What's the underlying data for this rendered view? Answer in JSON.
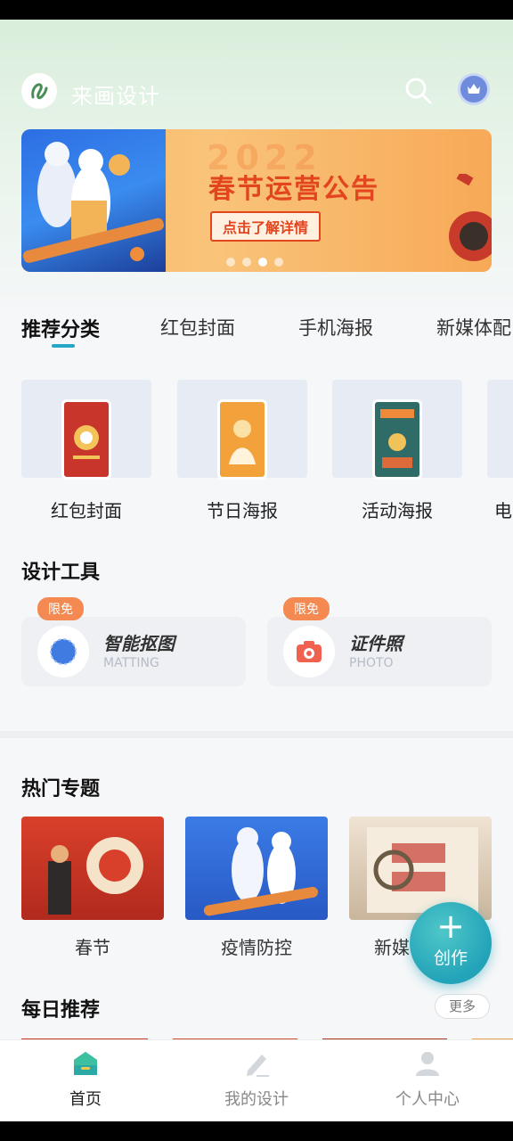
{
  "header": {
    "title": "来画设计"
  },
  "banner": {
    "year": "2022",
    "title": "春节运营公告",
    "cta": "点击了解详情",
    "dot_count": 4,
    "active_dot": 3
  },
  "tabs": [
    {
      "label": "推荐分类",
      "active": true
    },
    {
      "label": "红包封面",
      "active": false
    },
    {
      "label": "手机海报",
      "active": false
    },
    {
      "label": "新媒体配",
      "active": false
    }
  ],
  "categories": [
    {
      "label": "红包封面"
    },
    {
      "label": "节日海报"
    },
    {
      "label": "活动海报"
    },
    {
      "label": "电"
    }
  ],
  "tools_section": {
    "title": "设计工具",
    "items": [
      {
        "badge": "限免",
        "name": "智能抠图",
        "sub": "MATTING"
      },
      {
        "badge": "限免",
        "name": "证件照",
        "sub": "PHOTO"
      }
    ]
  },
  "hot_section": {
    "title": "热门专题",
    "items": [
      {
        "label": "春节"
      },
      {
        "label": "疫情防控"
      },
      {
        "label": "新媒"
      }
    ]
  },
  "daily_section": {
    "title": "每日推荐",
    "more": "更多"
  },
  "fab": {
    "label": "创作"
  },
  "bottom_nav": [
    {
      "label": "首页",
      "active": true
    },
    {
      "label": "我的设计",
      "active": false
    },
    {
      "label": "个人中心",
      "active": false
    }
  ],
  "colors": {
    "accent": "#27a7c8",
    "badge": "#f48a51",
    "banner_text": "#e3451f"
  }
}
